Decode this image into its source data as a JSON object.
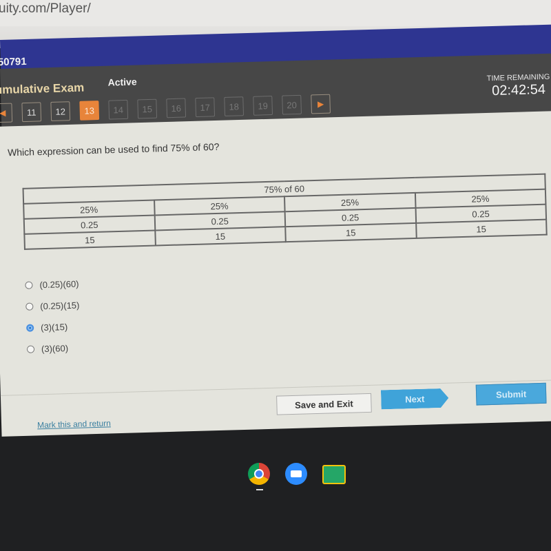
{
  "browser": {
    "url_fragment": "uity.com/Player/"
  },
  "header": {
    "code": "50791",
    "exam_title": "umulative Exam",
    "status": "Active",
    "time_remaining_label": "TIME REMAINING",
    "time_remaining": "02:42:54"
  },
  "question_nav": {
    "prev_icon": "◀",
    "next_icon": "▶",
    "questions": [
      {
        "num": "11",
        "state": "visited"
      },
      {
        "num": "12",
        "state": "visited"
      },
      {
        "num": "13",
        "state": "current"
      },
      {
        "num": "14",
        "state": "locked"
      },
      {
        "num": "15",
        "state": "locked"
      },
      {
        "num": "16",
        "state": "locked"
      },
      {
        "num": "17",
        "state": "locked"
      },
      {
        "num": "18",
        "state": "locked"
      },
      {
        "num": "19",
        "state": "locked"
      },
      {
        "num": "20",
        "state": "locked"
      }
    ]
  },
  "question": {
    "text": "Which expression can be used to find 75% of 60?",
    "table": {
      "header": "75% of 60",
      "columns": [
        [
          "25%",
          "0.25",
          "15"
        ],
        [
          "25%",
          "0.25",
          "15"
        ],
        [
          "25%",
          "0.25",
          "15"
        ],
        [
          "25%",
          "0.25",
          "15"
        ]
      ]
    },
    "options": [
      {
        "label": "(0.25)(60)",
        "selected": false
      },
      {
        "label": "(0.25)(15)",
        "selected": false
      },
      {
        "label": "(3)(15)",
        "selected": true
      },
      {
        "label": "(3)(60)",
        "selected": false
      }
    ]
  },
  "footer": {
    "mark_link": "Mark this and return",
    "save_exit": "Save and Exit",
    "next": "Next",
    "submit": "Submit"
  },
  "taskbar": {
    "apps": [
      "chrome-icon",
      "zoom-icon",
      "google-classroom-icon"
    ]
  }
}
